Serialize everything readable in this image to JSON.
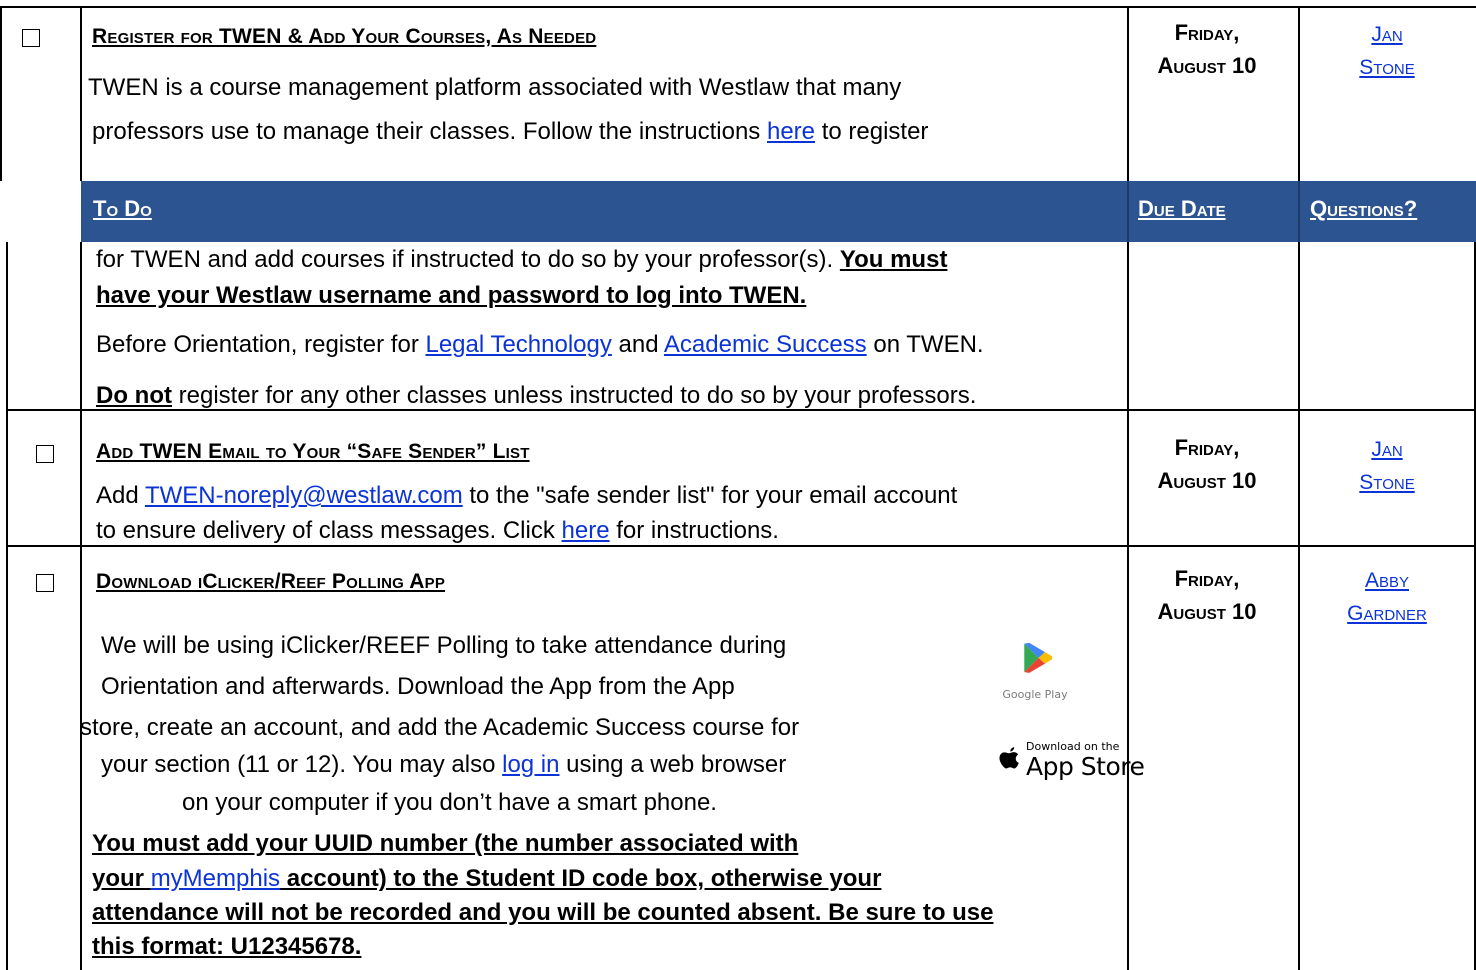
{
  "rows": {
    "twen": {
      "title": "Register for TWEN & Add Your Courses, As Needed",
      "p1_line1": "TWEN is a course management platform associated with Westlaw that many",
      "p1_line2_a": "professors use to manage their classes.  Follow the instructions ",
      "p1_line2_link": "here",
      "p1_line2_b": " to register",
      "p1_line3_a": "for TWEN and add courses if instructed to do so by your professor(s).  ",
      "p1_line3_bold": "You must",
      "p1_line4_bold": "have your Westlaw username and password to log into TWEN.",
      "p2_a": "Before Orientation, register for ",
      "p2_link1": "Legal Technology",
      "p2_b": " and ",
      "p2_link2": "Academic Success",
      "p2_c": " on TWEN.",
      "p3_bold": "Do not",
      "p3_rest": " register for any other classes unless instructed to do so by your professors.",
      "due_line1": "Friday,",
      "due_line2": "August 10",
      "contact_line1": "Jan",
      "contact_line2": "Stone"
    },
    "safe": {
      "title": "Add TWEN Email to Your “Safe Sender” List",
      "line1_a": "Add ",
      "line1_link": "TWEN-noreply@westlaw.com",
      "line1_b": " to the \"safe sender list\" for your email account",
      "line2_a": "to ensure delivery of class messages.  Click ",
      "line2_link": "here",
      "line2_b": " for instructions.",
      "due_line1": "Friday,",
      "due_line2": "August 10",
      "contact_line1": "Jan",
      "contact_line2": "Stone"
    },
    "iclicker": {
      "title": "Download iClicker/Reef Polling App",
      "l1": "We will be using iClicker/REEF Polling to take attendance during",
      "l2": "Orientation and afterwards.  Download the App from the App",
      "l3": "store, create an account, and add the Academic Success course for",
      "l4_a": "your section (11 or 12).  You may also ",
      "l4_link": "log in",
      "l4_b": " using a web browser",
      "l5": "on your computer if you don’t have a smart phone.",
      "b1": "You must add your UUID number (the number associated with",
      "b2_a": "your ",
      "b2_link": "myMemphis",
      "b2_b": " account) to the Student ID code box, otherwise your",
      "b3": "attendance will not be recorded and you will be counted absent.  Be sure to use",
      "b4": "this format:  U12345678.",
      "google_play": "Google Play",
      "app_store_small": "Download on the",
      "app_store_big": "App Store",
      "due_line1": "Friday,",
      "due_line2": "August 10",
      "contact_line1": "Abby",
      "contact_line2": "Gardner"
    }
  },
  "header": {
    "todo": "To Do",
    "due": "Due Date",
    "questions": "Questions?"
  },
  "colors": {
    "header_bg": "#2c5490",
    "link": "#0b33d6"
  }
}
